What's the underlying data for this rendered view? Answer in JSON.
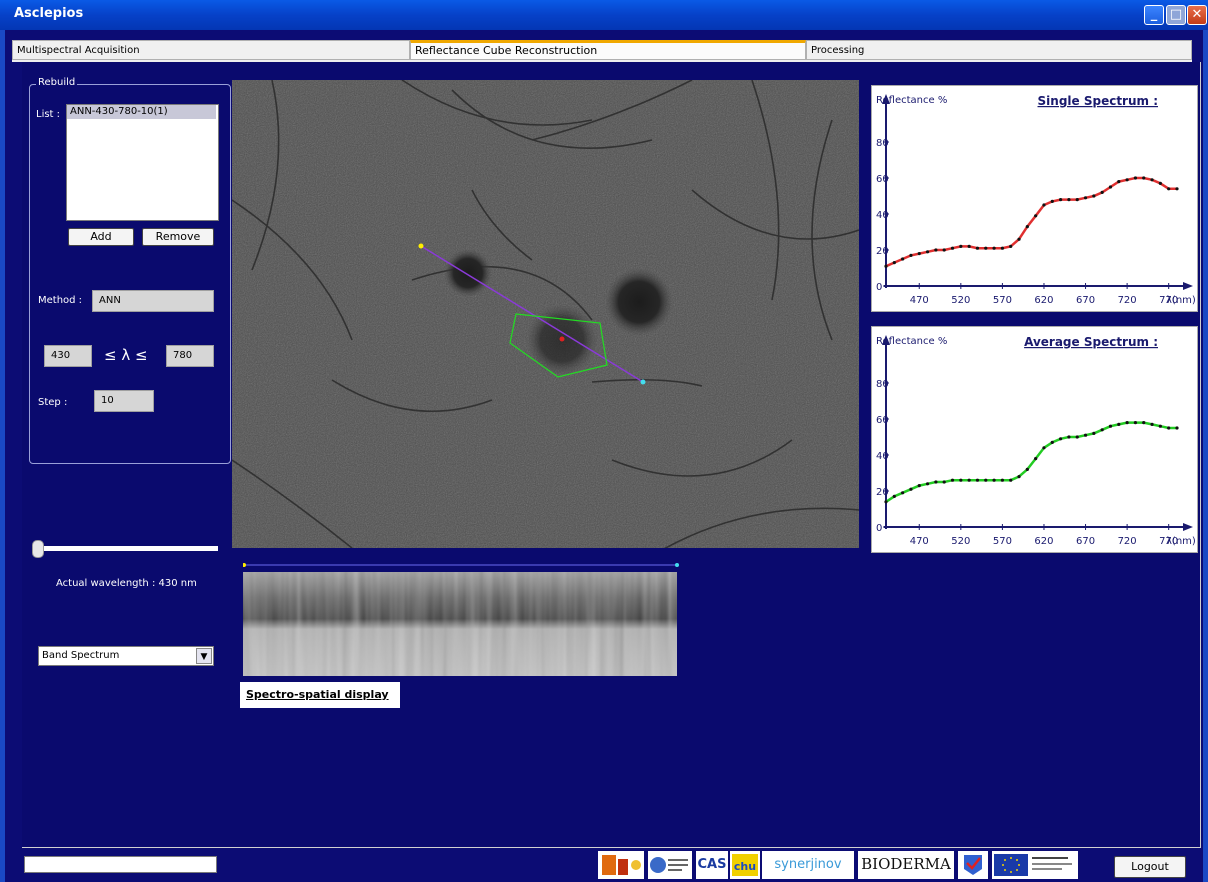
{
  "window": {
    "title": "Asclepios"
  },
  "tabs": [
    {
      "label": "Multispectral Acquisition"
    },
    {
      "label": "Reflectance Cube Reconstruction"
    },
    {
      "label": "Processing"
    }
  ],
  "rebuild": {
    "legend": "Rebuild",
    "list_label": "List :",
    "list_items": [
      "ANN-430-780-10(1)"
    ],
    "add_label": "Add",
    "remove_label": "Remove",
    "method_label": "Method :",
    "method_value": "ANN",
    "lambda_min": "430",
    "lambda_symbol": "≤ λ ≤",
    "lambda_max": "780",
    "step_label": "Step :",
    "step_value": "10"
  },
  "wavelength": {
    "slider_fraction": 0.0,
    "text": "Actual wavelength : 430 nm"
  },
  "display_mode": {
    "selected": "Band Spectrum"
  },
  "spectro_caption": "Spectro-spatial display",
  "logout_label": "Logout",
  "logos": {
    "synerjinov": "synerjinov",
    "bioderma": "BIODERMA",
    "cas": "CAS"
  },
  "colors": {
    "background": "#0a0a6e",
    "single_series": "#e03030",
    "average_series": "#22cc22",
    "axis": "#1a1a6e",
    "roi": "#22dd22",
    "profile_line": "#8a3ad8"
  },
  "chart_data": [
    {
      "type": "line",
      "title": "Single Spectrum :",
      "ylabel": "Reflectance %",
      "xlabel": "λ(nm)",
      "ylim": [
        0,
        100
      ],
      "xlim": [
        430,
        780
      ],
      "xticks": [
        470,
        520,
        570,
        620,
        670,
        720,
        770
      ],
      "yticks": [
        0,
        20,
        40,
        60,
        80
      ],
      "series": [
        {
          "color": "#e03030",
          "x": [
            430,
            440,
            450,
            460,
            470,
            480,
            490,
            500,
            510,
            520,
            530,
            540,
            550,
            560,
            570,
            580,
            590,
            600,
            610,
            620,
            630,
            640,
            650,
            660,
            670,
            680,
            690,
            700,
            710,
            720,
            730,
            740,
            750,
            760,
            770,
            780
          ],
          "y": [
            11,
            13,
            15,
            17,
            18,
            19,
            20,
            20,
            21,
            22,
            22,
            21,
            21,
            21,
            21,
            22,
            26,
            33,
            39,
            45,
            47,
            48,
            48,
            48,
            49,
            50,
            52,
            55,
            58,
            59,
            60,
            60,
            59,
            57,
            54,
            54
          ]
        }
      ]
    },
    {
      "type": "line",
      "title": "Average Spectrum :",
      "ylabel": "Reflectance %",
      "xlabel": "λ(nm)",
      "ylim": [
        0,
        100
      ],
      "xlim": [
        430,
        780
      ],
      "xticks": [
        470,
        520,
        570,
        620,
        670,
        720,
        770
      ],
      "yticks": [
        0,
        20,
        40,
        60,
        80
      ],
      "series": [
        {
          "color": "#22cc22",
          "x": [
            430,
            440,
            450,
            460,
            470,
            480,
            490,
            500,
            510,
            520,
            530,
            540,
            550,
            560,
            570,
            580,
            590,
            600,
            610,
            620,
            630,
            640,
            650,
            660,
            670,
            680,
            690,
            700,
            710,
            720,
            730,
            740,
            750,
            760,
            770,
            780
          ],
          "y": [
            14,
            17,
            19,
            21,
            23,
            24,
            25,
            25,
            26,
            26,
            26,
            26,
            26,
            26,
            26,
            26,
            28,
            32,
            38,
            44,
            47,
            49,
            50,
            50,
            51,
            52,
            54,
            56,
            57,
            58,
            58,
            58,
            57,
            56,
            55,
            55
          ]
        }
      ]
    }
  ]
}
